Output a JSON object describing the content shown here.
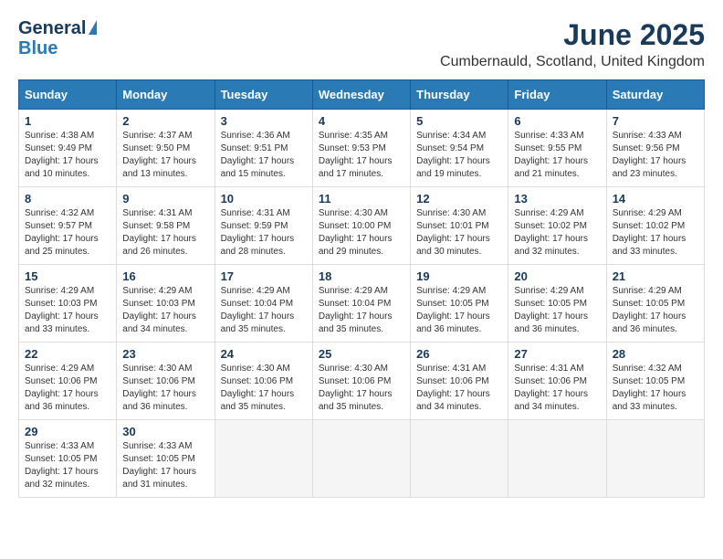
{
  "header": {
    "logo_general": "General",
    "logo_blue": "Blue",
    "month_title": "June 2025",
    "location": "Cumbernauld, Scotland, United Kingdom"
  },
  "calendar": {
    "days_of_week": [
      "Sunday",
      "Monday",
      "Tuesday",
      "Wednesday",
      "Thursday",
      "Friday",
      "Saturday"
    ],
    "weeks": [
      [
        {
          "day": "1",
          "info": "Sunrise: 4:38 AM\nSunset: 9:49 PM\nDaylight: 17 hours\nand 10 minutes."
        },
        {
          "day": "2",
          "info": "Sunrise: 4:37 AM\nSunset: 9:50 PM\nDaylight: 17 hours\nand 13 minutes."
        },
        {
          "day": "3",
          "info": "Sunrise: 4:36 AM\nSunset: 9:51 PM\nDaylight: 17 hours\nand 15 minutes."
        },
        {
          "day": "4",
          "info": "Sunrise: 4:35 AM\nSunset: 9:53 PM\nDaylight: 17 hours\nand 17 minutes."
        },
        {
          "day": "5",
          "info": "Sunrise: 4:34 AM\nSunset: 9:54 PM\nDaylight: 17 hours\nand 19 minutes."
        },
        {
          "day": "6",
          "info": "Sunrise: 4:33 AM\nSunset: 9:55 PM\nDaylight: 17 hours\nand 21 minutes."
        },
        {
          "day": "7",
          "info": "Sunrise: 4:33 AM\nSunset: 9:56 PM\nDaylight: 17 hours\nand 23 minutes."
        }
      ],
      [
        {
          "day": "8",
          "info": "Sunrise: 4:32 AM\nSunset: 9:57 PM\nDaylight: 17 hours\nand 25 minutes."
        },
        {
          "day": "9",
          "info": "Sunrise: 4:31 AM\nSunset: 9:58 PM\nDaylight: 17 hours\nand 26 minutes."
        },
        {
          "day": "10",
          "info": "Sunrise: 4:31 AM\nSunset: 9:59 PM\nDaylight: 17 hours\nand 28 minutes."
        },
        {
          "day": "11",
          "info": "Sunrise: 4:30 AM\nSunset: 10:00 PM\nDaylight: 17 hours\nand 29 minutes."
        },
        {
          "day": "12",
          "info": "Sunrise: 4:30 AM\nSunset: 10:01 PM\nDaylight: 17 hours\nand 30 minutes."
        },
        {
          "day": "13",
          "info": "Sunrise: 4:29 AM\nSunset: 10:02 PM\nDaylight: 17 hours\nand 32 minutes."
        },
        {
          "day": "14",
          "info": "Sunrise: 4:29 AM\nSunset: 10:02 PM\nDaylight: 17 hours\nand 33 minutes."
        }
      ],
      [
        {
          "day": "15",
          "info": "Sunrise: 4:29 AM\nSunset: 10:03 PM\nDaylight: 17 hours\nand 33 minutes."
        },
        {
          "day": "16",
          "info": "Sunrise: 4:29 AM\nSunset: 10:03 PM\nDaylight: 17 hours\nand 34 minutes."
        },
        {
          "day": "17",
          "info": "Sunrise: 4:29 AM\nSunset: 10:04 PM\nDaylight: 17 hours\nand 35 minutes."
        },
        {
          "day": "18",
          "info": "Sunrise: 4:29 AM\nSunset: 10:04 PM\nDaylight: 17 hours\nand 35 minutes."
        },
        {
          "day": "19",
          "info": "Sunrise: 4:29 AM\nSunset: 10:05 PM\nDaylight: 17 hours\nand 36 minutes."
        },
        {
          "day": "20",
          "info": "Sunrise: 4:29 AM\nSunset: 10:05 PM\nDaylight: 17 hours\nand 36 minutes."
        },
        {
          "day": "21",
          "info": "Sunrise: 4:29 AM\nSunset: 10:05 PM\nDaylight: 17 hours\nand 36 minutes."
        }
      ],
      [
        {
          "day": "22",
          "info": "Sunrise: 4:29 AM\nSunset: 10:06 PM\nDaylight: 17 hours\nand 36 minutes."
        },
        {
          "day": "23",
          "info": "Sunrise: 4:30 AM\nSunset: 10:06 PM\nDaylight: 17 hours\nand 36 minutes."
        },
        {
          "day": "24",
          "info": "Sunrise: 4:30 AM\nSunset: 10:06 PM\nDaylight: 17 hours\nand 35 minutes."
        },
        {
          "day": "25",
          "info": "Sunrise: 4:30 AM\nSunset: 10:06 PM\nDaylight: 17 hours\nand 35 minutes."
        },
        {
          "day": "26",
          "info": "Sunrise: 4:31 AM\nSunset: 10:06 PM\nDaylight: 17 hours\nand 34 minutes."
        },
        {
          "day": "27",
          "info": "Sunrise: 4:31 AM\nSunset: 10:06 PM\nDaylight: 17 hours\nand 34 minutes."
        },
        {
          "day": "28",
          "info": "Sunrise: 4:32 AM\nSunset: 10:05 PM\nDaylight: 17 hours\nand 33 minutes."
        }
      ],
      [
        {
          "day": "29",
          "info": "Sunrise: 4:33 AM\nSunset: 10:05 PM\nDaylight: 17 hours\nand 32 minutes."
        },
        {
          "day": "30",
          "info": "Sunrise: 4:33 AM\nSunset: 10:05 PM\nDaylight: 17 hours\nand 31 minutes."
        },
        {
          "day": "",
          "info": ""
        },
        {
          "day": "",
          "info": ""
        },
        {
          "day": "",
          "info": ""
        },
        {
          "day": "",
          "info": ""
        },
        {
          "day": "",
          "info": ""
        }
      ]
    ]
  }
}
